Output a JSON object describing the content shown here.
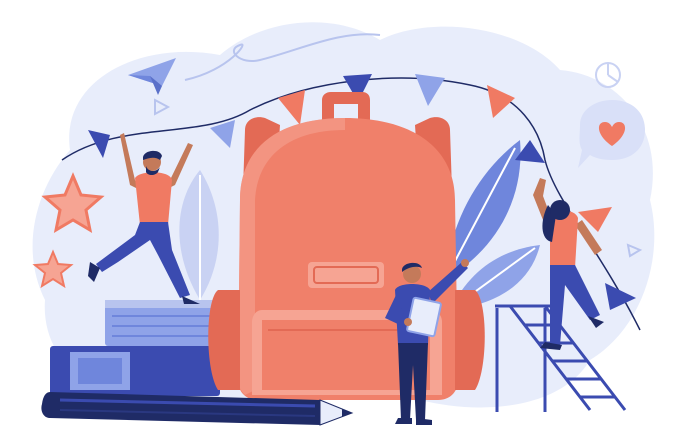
{
  "illustration": {
    "subject": "back-to-school",
    "palette": {
      "background_blob": "#e8edfb",
      "backpack": "#f0806a",
      "backpack_dark": "#e36a55",
      "navy": "#1f2b66",
      "indigo": "#3b4bb0",
      "periwinkle": "#8fa3e8",
      "coral": "#f07a63",
      "light_coral": "#f6a493",
      "skin": "#c47a5a",
      "white": "#ffffff"
    },
    "icons": [
      "paper-plane-icon",
      "heart-speech-bubble-icon",
      "star-icon",
      "pennant-flag-icon",
      "leaf-icon",
      "pencil-icon",
      "book-stack-icon",
      "ladder-icon",
      "clipboard-icon"
    ]
  }
}
